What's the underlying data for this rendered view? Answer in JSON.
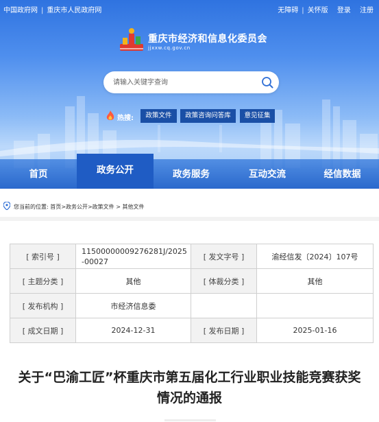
{
  "topbar": {
    "left_links": [
      "中国政府网",
      "重庆市人民政府网"
    ],
    "right_links": [
      "无障碍",
      "关怀版",
      "登录",
      "注册"
    ]
  },
  "site": {
    "title": "重庆市经济和信息化委员会",
    "domain": "jjxxw.cq.gov.cn"
  },
  "search": {
    "placeholder": "请输入关键字查询"
  },
  "hot": {
    "label": "热搜:",
    "tags": [
      "政策文件",
      "政策咨询问答库",
      "意见征集"
    ]
  },
  "nav": {
    "items": [
      "首页",
      "政务公开",
      "政务服务",
      "互动交流",
      "经信数据"
    ],
    "active": "政务公开"
  },
  "breadcrumb": {
    "prefix": "您当前的位置:",
    "path": "首页>政务公开>政策文件 > 其他文件"
  },
  "info_table": {
    "index_label": "[ 索引号 ]",
    "index_value": "11500000009276281J/2025-00027",
    "docno_label": "[ 发文字号 ]",
    "docno_value": "渝经信发〔2024〕107号",
    "topic_label": "[ 主题分类 ]",
    "topic_value": "其他",
    "genre_label": "[ 体裁分类 ]",
    "genre_value": "其他",
    "issuer_label": "[ 发布机构 ]",
    "issuer_value": "市经济信息委",
    "written_label": "[ 成文日期 ]",
    "written_value": "2024-12-31",
    "publish_label": "[ 发布日期 ]",
    "publish_value": "2025-01-16"
  },
  "article": {
    "title_line1": "关于“巴渝工匠”杯重庆市第五届化工行业职业技能竞赛获奖",
    "title_line2": "情况的通报"
  },
  "colors": {
    "header_blue": "#2f73e0",
    "nav_active": "#1f5cc4",
    "tag_bg": "#1a4fa6",
    "label_cell_bg": "#f2f2f2"
  },
  "icons": [
    "logo-emblem",
    "search-icon",
    "flame-icon",
    "location-pin-icon"
  ]
}
